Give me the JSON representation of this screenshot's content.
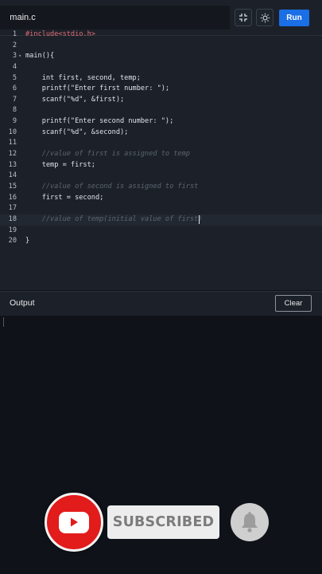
{
  "tabs": [
    {
      "label": "main.c"
    }
  ],
  "toolbar": {
    "fullscreen_icon": "compress-icon",
    "theme_icon": "sun-icon",
    "run_label": "Run"
  },
  "code_lines": [
    {
      "n": "1",
      "text": "#include<stdio.h>"
    },
    {
      "n": "2",
      "text": ""
    },
    {
      "n": "3",
      "text": "main(){"
    },
    {
      "n": "4",
      "text": ""
    },
    {
      "n": "5",
      "text": "    int first, second, temp;"
    },
    {
      "n": "6",
      "text": "    printf(\"Enter first number: \");"
    },
    {
      "n": "7",
      "text": "    scanf(\"%d\", &first);"
    },
    {
      "n": "8",
      "text": ""
    },
    {
      "n": "9",
      "text": "    printf(\"Enter second number: \");"
    },
    {
      "n": "10",
      "text": "    scanf(\"%d\", &second);"
    },
    {
      "n": "11",
      "text": ""
    },
    {
      "n": "12",
      "text": "    //value of first is assigned to temp"
    },
    {
      "n": "13",
      "text": "    temp = first;"
    },
    {
      "n": "14",
      "text": ""
    },
    {
      "n": "15",
      "text": "    //value of second is assigned to first"
    },
    {
      "n": "16",
      "text": "    first = second;"
    },
    {
      "n": "17",
      "text": ""
    },
    {
      "n": "18",
      "text": "    //value of temp(initial value of first)"
    },
    {
      "n": "19",
      "text": ""
    },
    {
      "n": "20",
      "text": "}"
    }
  ],
  "output": {
    "title": "Output",
    "clear_label": "Clear"
  },
  "overlay": {
    "subscribed_label": "SUBSCRIBED",
    "youtube_icon": "youtube-logo",
    "bell_icon": "bell-icon",
    "colors": {
      "red": "#e21b1b",
      "box": "#ededed",
      "text": "#7c7c7c"
    }
  },
  "colors": {
    "run_button": "#1a6ee6",
    "editor_bg": "#1c2129",
    "output_bg": "#0f1319"
  }
}
